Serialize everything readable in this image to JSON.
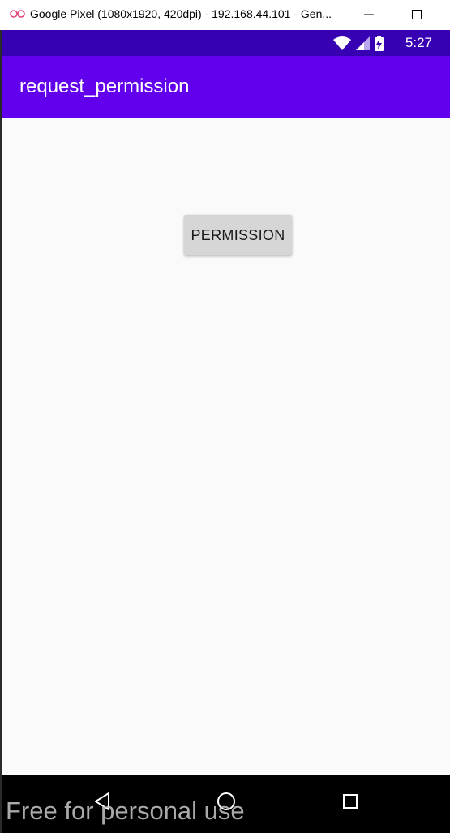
{
  "window": {
    "title": "Google Pixel (1080x1920, 420dpi) - 192.168.44.101 - Gen...",
    "minimize_label": "—",
    "maximize_label": "☐"
  },
  "status_bar": {
    "time": "5:27",
    "icons": [
      "wifi-icon",
      "cell-signal-icon",
      "battery-charging-icon"
    ],
    "color": "#3700b3"
  },
  "app_bar": {
    "title": "request_permission",
    "color": "#6200ee"
  },
  "main": {
    "permission_button_label": "PERMISSION"
  },
  "nav_bar": {
    "icons": [
      "back-icon",
      "home-icon",
      "recents-icon"
    ]
  },
  "watermark": {
    "text": "Free for personal use"
  }
}
